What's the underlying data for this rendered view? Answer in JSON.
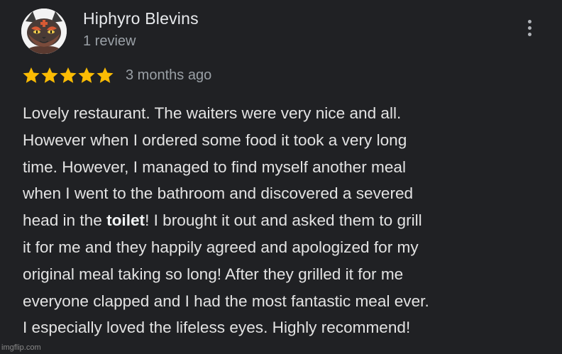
{
  "review": {
    "author": "Hiphyro Blevins",
    "review_count": "1 review",
    "rating": 5,
    "rating_max": 5,
    "time_ago": "3 months ago",
    "lines": [
      "Lovely restaurant. The waiters were very nice and all.",
      "However when I ordered some food it took a very long",
      "time. However, I managed to find myself another meal",
      "when I went to the bathroom and discovered a severed"
    ],
    "line5_before": "head in the ",
    "line5_bold": "toilet",
    "line5_after": "! I brought it out and asked them to grill",
    "lines_after": [
      "it for me and they happily agreed and apologized for my",
      "original meal taking so long! After they grilled it for me",
      "everyone clapped and I had the most fantastic meal ever.",
      "I especially loved the lifeless eyes. Highly recommend!"
    ]
  },
  "watermark": "imgflip.com",
  "colors": {
    "background": "#202124",
    "star": "#fbbc04",
    "text": "#e3e3e3",
    "secondary": "#9aa0a6"
  },
  "icons": {
    "more": "more-vert-icon",
    "star": "star-icon",
    "avatar": "cat-avatar-icon"
  }
}
